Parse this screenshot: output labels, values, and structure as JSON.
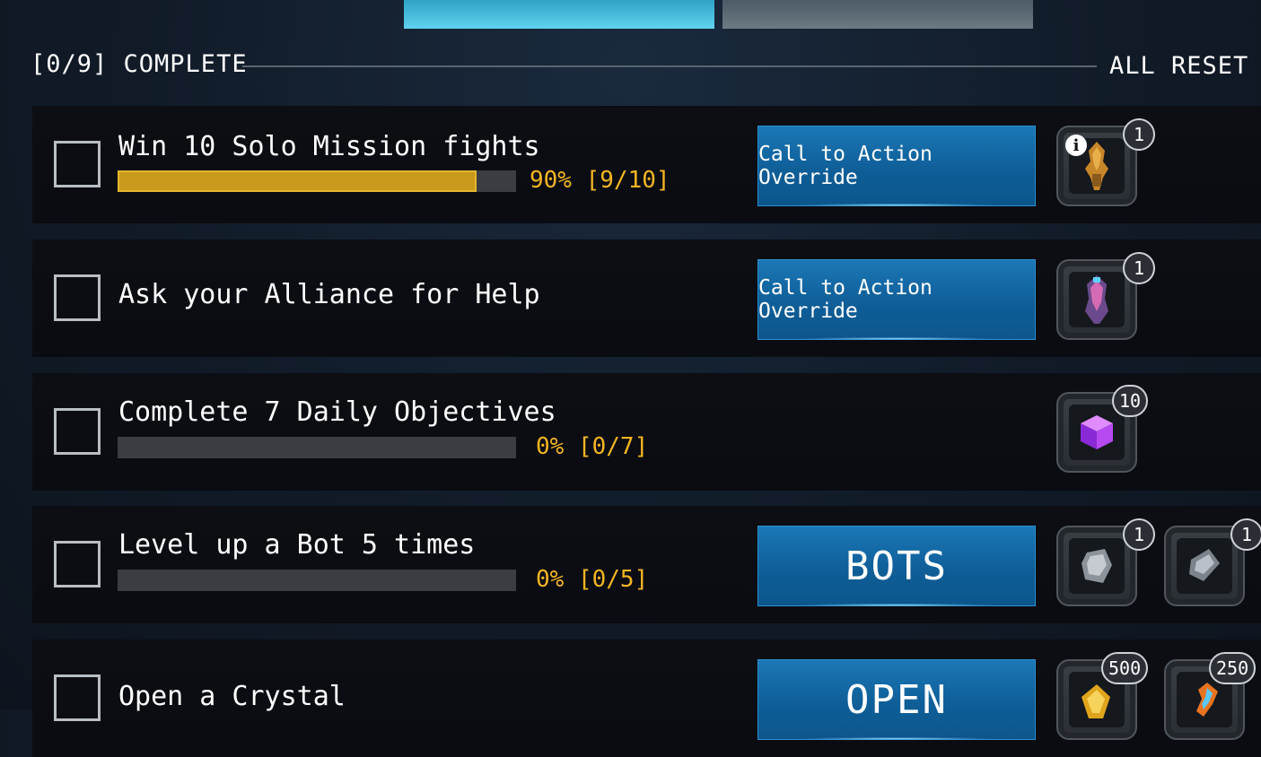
{
  "header": {
    "complete_text": "[0/9] COMPLETE",
    "reset_text": "ALL RESET IN"
  },
  "tasks": [
    {
      "title": "Win 10 Solo Mission fights",
      "progress_percent": 90,
      "progress_text": "90%  [9/10]",
      "button": "Call to Action Override",
      "rewards": [
        {
          "icon": "gold-robot-shard-icon",
          "count": "1",
          "info": "i"
        }
      ]
    },
    {
      "title": "Ask your Alliance for Help",
      "button": "Call to Action Override",
      "rewards": [
        {
          "icon": "pink-robot-shard-icon",
          "count": "1"
        }
      ]
    },
    {
      "title": "Complete 7 Daily Objectives",
      "progress_percent": 0,
      "progress_text": "0%  [0/7]",
      "rewards": [
        {
          "icon": "purple-cube-icon",
          "count": "10"
        }
      ]
    },
    {
      "title": "Level up a Bot 5 times",
      "progress_percent": 0,
      "progress_text": "0%  [0/5]",
      "button": "BOTS",
      "rewards": [
        {
          "icon": "metal-part-icon",
          "count": "1"
        },
        {
          "icon": "metal-plate-icon",
          "count": "1"
        }
      ]
    },
    {
      "title": "Open a Crystal",
      "button": "OPEN",
      "rewards": [
        {
          "icon": "gold-crystal-icon",
          "count": "500"
        },
        {
          "icon": "orange-shard-icon",
          "count": "250"
        }
      ]
    }
  ],
  "colors": {
    "accent_gold": "#f4b523",
    "button_blue": "#0f5e98",
    "active_tab": "#5fd3ef"
  }
}
